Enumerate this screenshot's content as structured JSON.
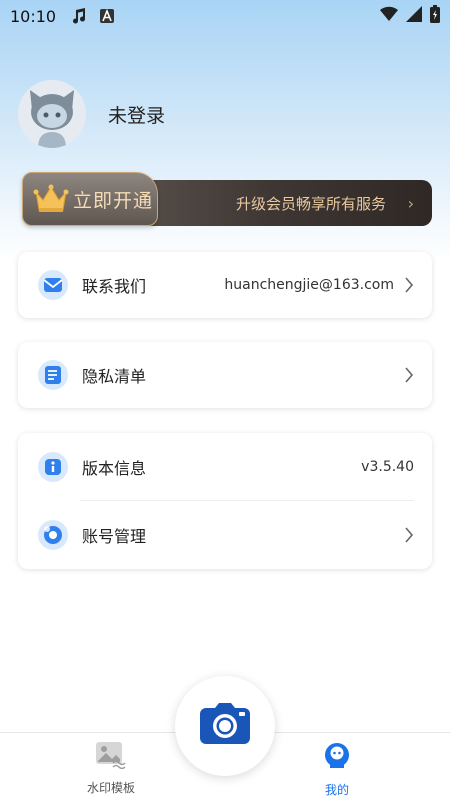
{
  "status_bar": {
    "time": "10:10",
    "icons": [
      "music-note-icon",
      "text-a-icon",
      "wifi-icon",
      "signal-icon",
      "battery-icon"
    ]
  },
  "profile": {
    "name": "未登录",
    "avatar_icon": "cat-avatar-icon"
  },
  "vip": {
    "cta": "立即开通",
    "description": "升级会员畅享所有服务",
    "arrow": "›"
  },
  "menu": {
    "contact": {
      "label": "联系我们",
      "value": "huanchengjie@163.com",
      "icon": "mail-icon"
    },
    "privacy": {
      "label": "隐私清单",
      "icon": "list-icon"
    },
    "version": {
      "label": "版本信息",
      "value": "v3.5.40",
      "icon": "info-icon"
    },
    "account": {
      "label": "账号管理",
      "icon": "account-icon"
    }
  },
  "bottom_nav": {
    "watermark": {
      "label": "水印模板",
      "icon": "image-template-icon"
    },
    "camera": {
      "icon": "camera-icon"
    },
    "mine": {
      "label": "我的",
      "icon": "user-icon"
    }
  },
  "colors": {
    "accent": "#1a73e8",
    "vip_gold": "#f6dcb4",
    "nav_inactive": "#666666"
  }
}
